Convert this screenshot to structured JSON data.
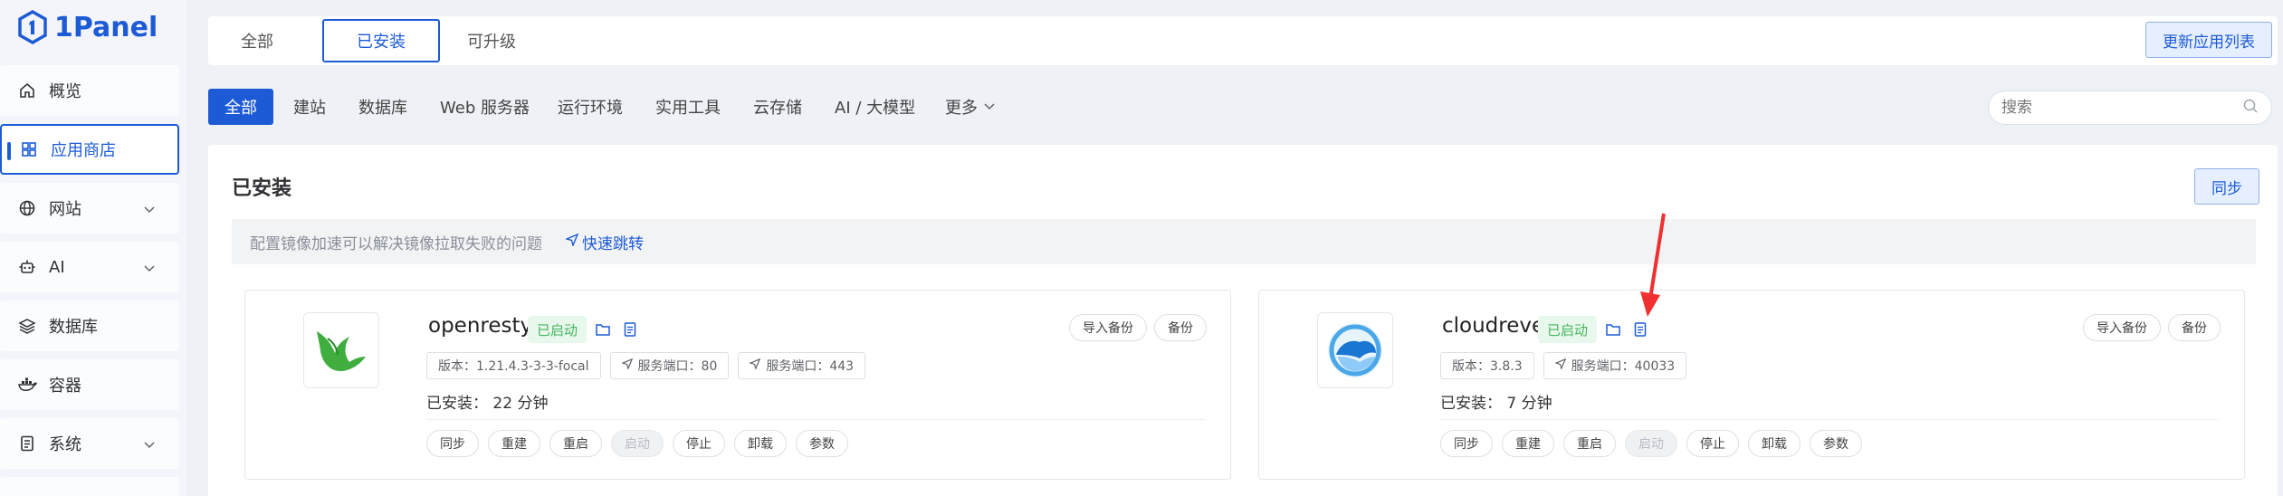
{
  "logo": {
    "text": "1Panel"
  },
  "sidebar": {
    "items": [
      {
        "label": "概览",
        "icon": "home-icon",
        "expandable": false
      },
      {
        "label": "应用商店",
        "icon": "grid-icon",
        "expandable": false,
        "active": true
      },
      {
        "label": "网站",
        "icon": "globe-icon",
        "expandable": true
      },
      {
        "label": "AI",
        "icon": "robot-icon",
        "expandable": true
      },
      {
        "label": "数据库",
        "icon": "layers-icon",
        "expandable": false
      },
      {
        "label": "容器",
        "icon": "docker-icon",
        "expandable": false
      },
      {
        "label": "系统",
        "icon": "system-icon",
        "expandable": true
      }
    ]
  },
  "top_tabs": {
    "items": [
      "全部",
      "已安装",
      "可升级"
    ],
    "active_index": 1,
    "update_button": "更新应用列表"
  },
  "categories": {
    "items": [
      "全部",
      "建站",
      "数据库",
      "Web 服务器",
      "运行环境",
      "实用工具",
      "云存储",
      "AI / 大模型",
      "更多"
    ],
    "active_index": 0,
    "search_placeholder": "搜索"
  },
  "panel": {
    "title": "已安装",
    "sync_button": "同步",
    "notice_text": "配置镜像加速可以解决镜像拉取失败的问题",
    "notice_link": "快速跳转"
  },
  "apps": [
    {
      "name": "openresty",
      "status": "已启动",
      "version": "版本：1.21.4.3-3-3-focal",
      "port": "服务端口：80",
      "port2": "服务端口：443",
      "installed": "已安装： 22 分钟",
      "import_backup": "导入备份",
      "backup": "备份",
      "ops": [
        "同步",
        "重建",
        "重启",
        "启动",
        "停止",
        "卸载",
        "参数"
      ],
      "disabled_op_index": 3
    },
    {
      "name": "cloudreve",
      "status": "已启动",
      "version": "版本：3.8.3",
      "port": "服务端口：40033",
      "installed": "已安装： 7 分钟",
      "import_backup": "导入备份",
      "backup": "备份",
      "ops": [
        "同步",
        "重建",
        "重启",
        "启动",
        "停止",
        "卸载",
        "参数"
      ],
      "disabled_op_index": 3
    }
  ],
  "colors": {
    "accent": "#1d5bd6",
    "status_green": "#46b35e",
    "annotation_arrow": "#f03030"
  }
}
